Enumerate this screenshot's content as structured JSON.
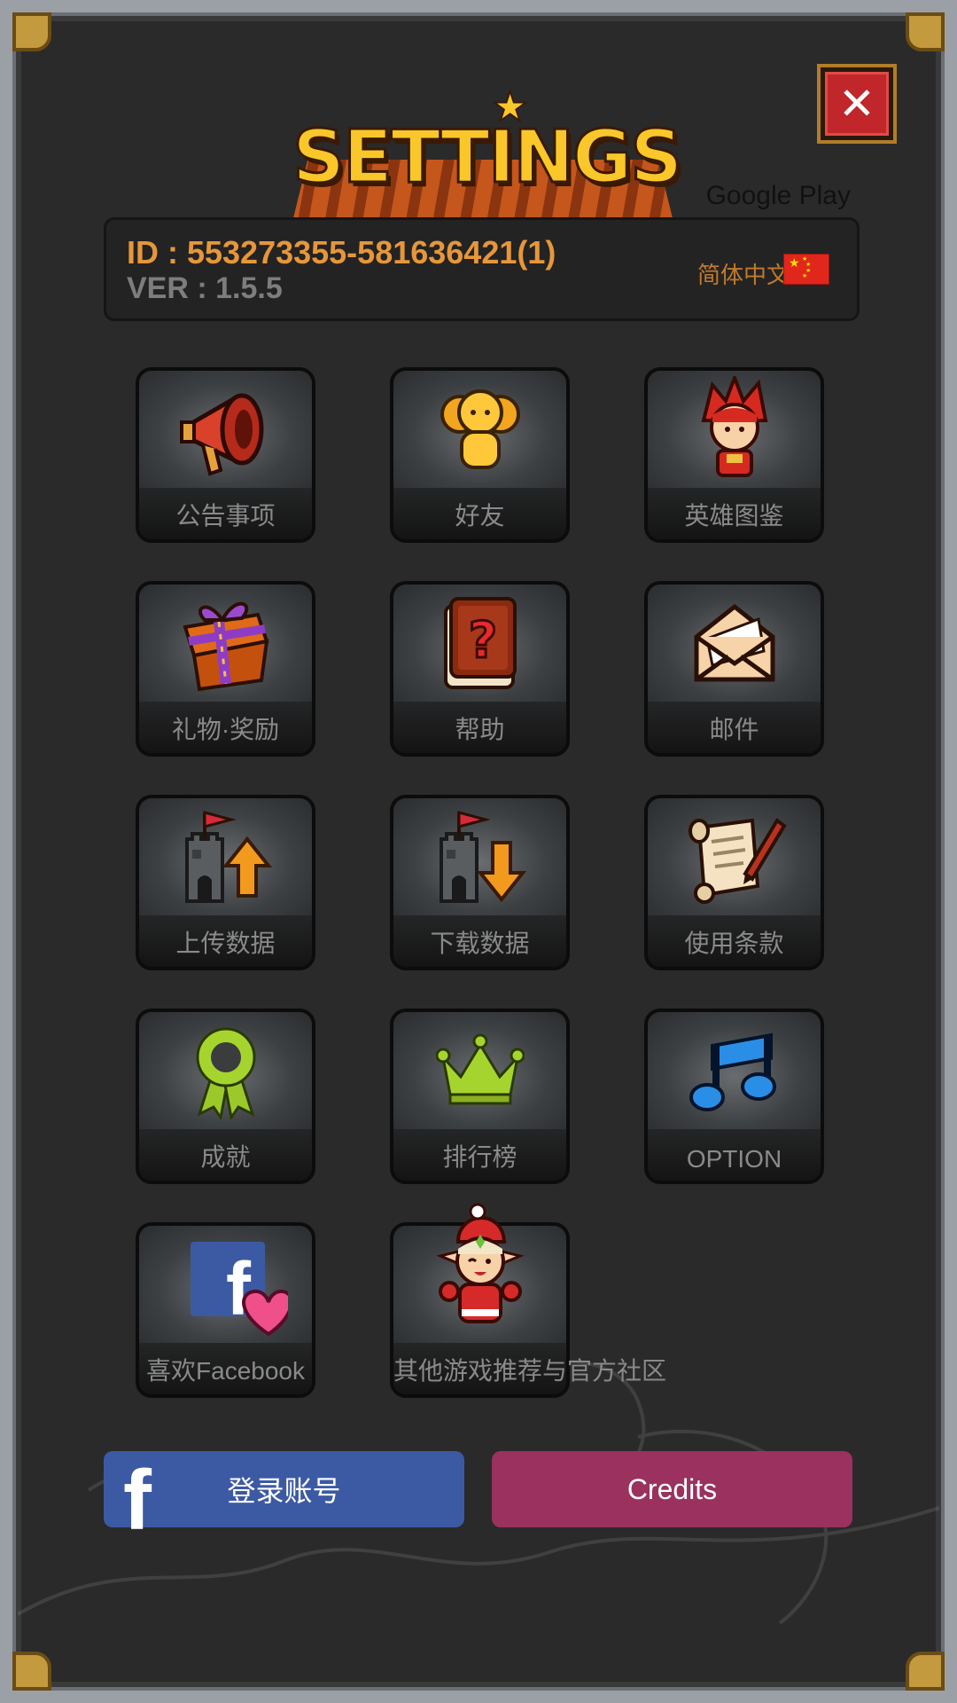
{
  "window": {
    "title": "SETTINGS",
    "close_symbol": "✕",
    "store_label": "Google Play"
  },
  "info": {
    "id_text": "ID : 553273355-581636421(1)",
    "version_text": "VER : 1.5.5",
    "language_label": "简体中文",
    "flag_icon": "china-flag-icon"
  },
  "tiles": [
    {
      "icon": "megaphone-icon",
      "label": "公告事项"
    },
    {
      "icon": "friends-icon",
      "label": "好友"
    },
    {
      "icon": "hero-icon",
      "label": "英雄图鉴"
    },
    {
      "icon": "gift-icon",
      "label": "礼物·奖励"
    },
    {
      "icon": "help-book-icon",
      "label": "帮助"
    },
    {
      "icon": "mail-icon",
      "label": "邮件"
    },
    {
      "icon": "castle-upload-icon",
      "label": "上传数据"
    },
    {
      "icon": "castle-download-icon",
      "label": "下载数据"
    },
    {
      "icon": "scroll-icon",
      "label": "使用条款"
    },
    {
      "icon": "award-ribbon-icon",
      "label": "成就"
    },
    {
      "icon": "crown-icon",
      "label": "排行榜"
    },
    {
      "icon": "music-note-icon",
      "label": "OPTION"
    },
    {
      "icon": "facebook-like-icon",
      "label": "喜欢Facebook"
    },
    {
      "icon": "elf-character-icon",
      "label": "其他游戏推荐与官方社区"
    }
  ],
  "buttons": {
    "facebook_label": "登录账号",
    "credits_label": "Credits"
  },
  "colors": {
    "id_text": "#e6973a",
    "version_text": "#7d7d7d",
    "facebook_button": "#3c5aa3",
    "credits_button": "#9a315e",
    "close_button": "#c0262a",
    "title": "#f9c72a"
  }
}
